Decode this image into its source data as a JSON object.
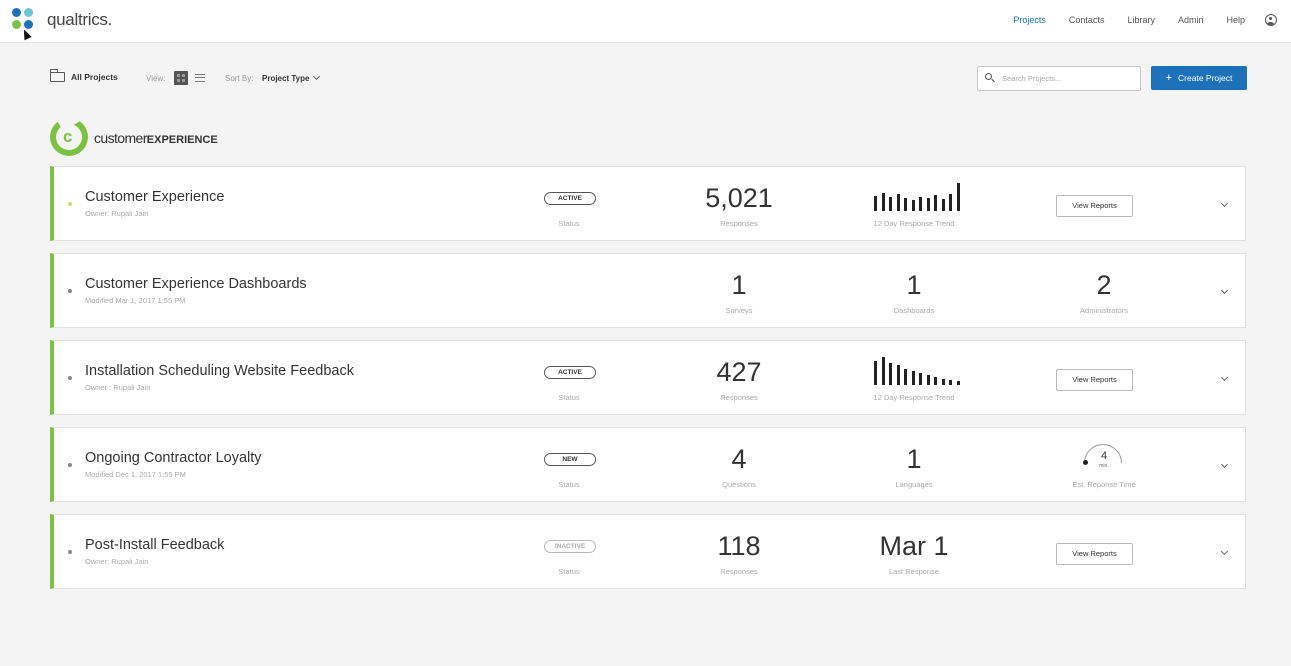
{
  "app": {
    "brand": "qualtrics."
  },
  "nav": {
    "items": [
      "Projects",
      "Contacts",
      "Library",
      "Admin",
      "Help"
    ],
    "active_index": 0
  },
  "toolbar": {
    "all_projects": "All Projects",
    "view_label": "View:",
    "sort_label": "Sort By:",
    "sort_value": "Project Type",
    "search_placeholder": "Search Projects...",
    "create_label": "Create Project"
  },
  "section": {
    "title_light": "customer",
    "title_bold": "EXPERIENCE",
    "accent": "#7cc242"
  },
  "colors": {
    "accent_green": "#7cc242",
    "primary_blue": "#1d71b8"
  },
  "projects": [
    {
      "title": "Customer Experience",
      "subtitle": "Owner: Rupali Jain",
      "status": "ACTIVE",
      "status_label": "Status",
      "metric_value": "5,021",
      "metric_label": "Responses",
      "trend_label": "12 Day Response Trend",
      "trend": [
        15,
        18,
        14,
        17,
        13,
        11,
        14,
        13,
        16,
        12,
        17,
        28
      ],
      "action": "View Reports"
    },
    {
      "title": "Customer Experience Dashboards",
      "subtitle": "Modified Mar 1, 2017 1:55 PM",
      "m1_value": "1",
      "m1_label": "Surveys",
      "m2_value": "1",
      "m2_label": "Dashboards",
      "m3_value": "2",
      "m3_label": "Administrators"
    },
    {
      "title": "Installation Scheduling Website Feedback",
      "subtitle": "Owner : Rupali Jain",
      "status": "ACTIVE",
      "status_label": "Status",
      "metric_value": "427",
      "metric_label": "Responses",
      "trend_label": "12 Day Response Trend",
      "trend": [
        24,
        28,
        22,
        20,
        16,
        14,
        12,
        10,
        8,
        6,
        5,
        4
      ],
      "action": "View Reports"
    },
    {
      "title": "Ongoing Contractor Loyalty",
      "subtitle": "Modified Dec 1, 2017 1:55 PM",
      "status": "NEW",
      "status_label": "Status",
      "m1_value": "4",
      "m1_label": "Questions",
      "m2_value": "1",
      "m2_label": "Languages",
      "gauge_value": "4",
      "gauge_unit": "min.",
      "gauge_label": "Est. Reponse Time"
    },
    {
      "title": "Post-Install Feedback",
      "subtitle": "Owner: Rupali Jain",
      "status": "INACTIVE",
      "status_label": "Status",
      "metric_value": "118",
      "metric_label": "Responses",
      "m2_value": "Mar 1",
      "m2_label": "Last Response",
      "action": "View Reports"
    }
  ]
}
